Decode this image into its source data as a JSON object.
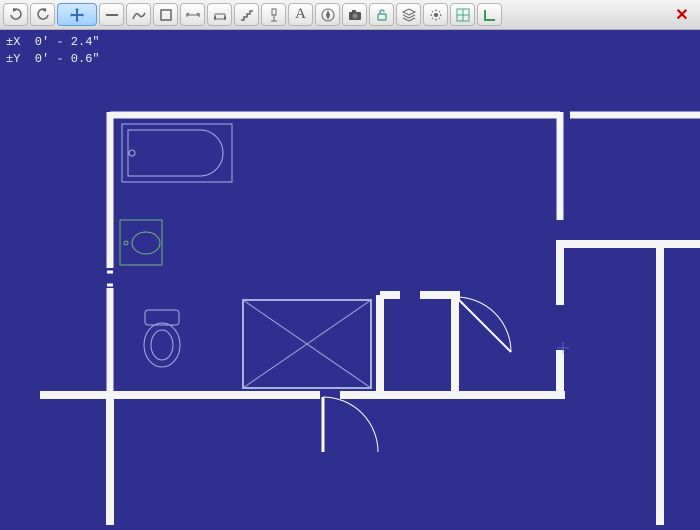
{
  "toolbar": {
    "undo_tip": "Undo",
    "redo_tip": "Redo",
    "move_tip": "Move",
    "line_tip": "Line",
    "freehand_tip": "Freehand",
    "rect_tip": "Rectangle",
    "dimension_tip": "Dimension",
    "sofa_tip": "Furniture",
    "stairs_tip": "Stairs",
    "fixture_tip": "Fixture",
    "text_label": "A",
    "compass_tip": "Compass",
    "camera_tip": "Camera",
    "lock_tip": "Lock",
    "layers_tip": "Layers",
    "settings_tip": "Settings",
    "grid_tip": "Grid",
    "corner_tip": "Corner",
    "close_label": "✕"
  },
  "coordinates": {
    "x_label": "±X  0' - 2.4\"",
    "y_label": "±Y  0' - 0.6\""
  },
  "colors": {
    "canvas_bg": "#2e2f8f",
    "wall": "#f5f5f5",
    "fixture": "#a8b0e0",
    "sink": "#6fb87a"
  }
}
